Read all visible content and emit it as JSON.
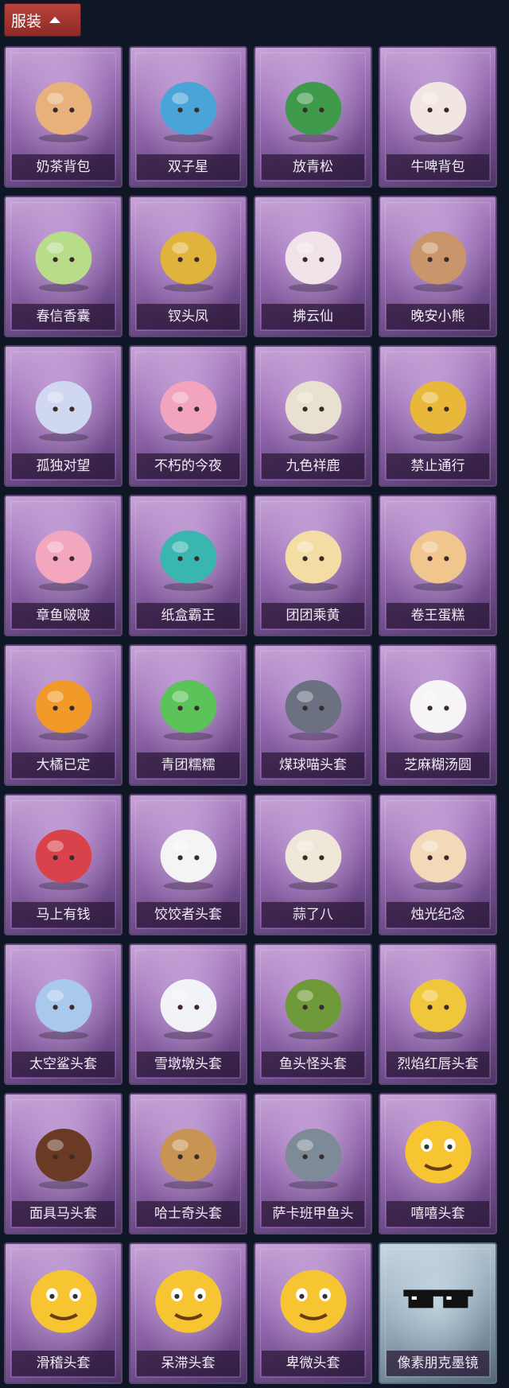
{
  "header": {
    "tab_label": "服装",
    "tab_icon": "chevron-up-icon"
  },
  "items": [
    {
      "label": "奶茶背包",
      "icon": "qr-teddy",
      "color": "#e8b07a"
    },
    {
      "label": "双子星",
      "icon": "globe-figure",
      "color": "#4aa4d8"
    },
    {
      "label": "放青松",
      "icon": "pine-tree",
      "color": "#3f9a4c"
    },
    {
      "label": "牛啤背包",
      "icon": "cow-barrel",
      "color": "#f2e6e2"
    },
    {
      "label": "春信香囊",
      "icon": "sachet",
      "color": "#b7dc8a"
    },
    {
      "label": "钗头凤",
      "icon": "phoenix-crown",
      "color": "#e0b43c"
    },
    {
      "label": "拂云仙",
      "icon": "cloud-fairy",
      "color": "#f0e4ea"
    },
    {
      "label": "晚安小熊",
      "icon": "bear-charm",
      "color": "#c8966a"
    },
    {
      "label": "孤独对望",
      "icon": "lonely-girl",
      "color": "#cfd8f0"
    },
    {
      "label": "不朽的今夜",
      "icon": "pink-fox",
      "color": "#f2a3bd"
    },
    {
      "label": "九色祥鹿",
      "icon": "deer",
      "color": "#e9e1cf"
    },
    {
      "label": "禁止通行",
      "icon": "no-entry-cone",
      "color": "#e9b83a"
    },
    {
      "label": "章鱼啵啵",
      "icon": "octopus",
      "color": "#f3a7bf"
    },
    {
      "label": "纸盒霸王",
      "icon": "box-dino",
      "color": "#39b6b0"
    },
    {
      "label": "团团乘黄",
      "icon": "round-cat",
      "color": "#f3dda5"
    },
    {
      "label": "卷王蛋糕",
      "icon": "roll-cake",
      "color": "#f0c58e"
    },
    {
      "label": "大橘已定",
      "icon": "orange-slice",
      "color": "#f19a2a"
    },
    {
      "label": "青团糯糯",
      "icon": "green-dumpling",
      "color": "#5cc25a"
    },
    {
      "label": "煤球喵头套",
      "icon": "gray-cat",
      "color": "#6b7180"
    },
    {
      "label": "芝麻糊汤圆",
      "icon": "tangyuan",
      "color": "#f6f4f6"
    },
    {
      "label": "马上有钱",
      "icon": "red-horse",
      "color": "#d9424a"
    },
    {
      "label": "饺饺者头套",
      "icon": "white-dumpling",
      "color": "#f4f4f4"
    },
    {
      "label": "蒜了八",
      "icon": "garlic",
      "color": "#efe7d8"
    },
    {
      "label": "烛光纪念",
      "icon": "candle",
      "color": "#f3d9b8"
    },
    {
      "label": "太空鲨头套",
      "icon": "shark",
      "color": "#a9c9ec"
    },
    {
      "label": "雪墩墩头套",
      "icon": "snowman",
      "color": "#f2f3f6"
    },
    {
      "label": "鱼头怪头套",
      "icon": "fish-head",
      "color": "#6e9a3a"
    },
    {
      "label": "烈焰红唇头套",
      "icon": "yellow-mask",
      "color": "#f0c63a"
    },
    {
      "label": "面具马头套",
      "icon": "horse-mask",
      "color": "#6b3a24"
    },
    {
      "label": "哈士奇头套",
      "icon": "husky",
      "color": "#c89454"
    },
    {
      "label": "萨卡班甲鱼头",
      "icon": "sacabambaspis",
      "color": "#7d8b98"
    },
    {
      "label": "嘻嘻头套",
      "icon": "grin-emoji",
      "color": "#f6c531"
    },
    {
      "label": "滑稽头套",
      "icon": "smirk-emoji",
      "color": "#f6c531"
    },
    {
      "label": "呆滞头套",
      "icon": "stare-emoji",
      "color": "#f6c531"
    },
    {
      "label": "卑微头套",
      "icon": "timid-emoji",
      "color": "#f6c531"
    },
    {
      "label": "像素朋克墨镜",
      "icon": "pixel-glasses",
      "color": "#111111",
      "special": true
    }
  ]
}
